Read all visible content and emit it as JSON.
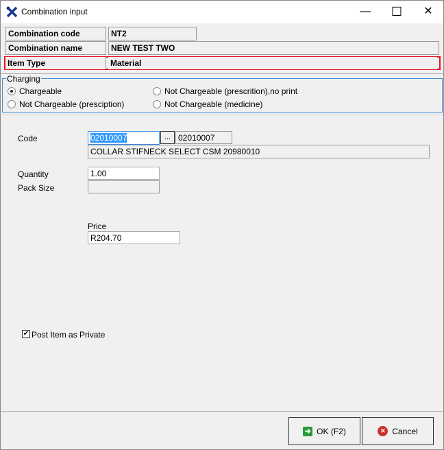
{
  "window": {
    "title": "Combination input",
    "minimize": "—",
    "maximize": "☐",
    "close": "✕"
  },
  "header": {
    "combination_code_label": "Combination code",
    "combination_code": "NT2",
    "combination_name_label": "Combination name",
    "combination_name": "NEW TEST TWO",
    "item_type_label": "Item Type",
    "item_type": "Material"
  },
  "charging": {
    "legend": "Charging",
    "options": [
      {
        "label": "Chargeable",
        "selected": true
      },
      {
        "label": "Not Chargeable (prescrition),no print",
        "selected": false
      },
      {
        "label": "Not Chargeable (presciption)",
        "selected": false
      },
      {
        "label": "Not Chargeable (medicine)",
        "selected": false
      }
    ]
  },
  "form": {
    "code_label": "Code",
    "code_value": "02010007",
    "browse_label": "...",
    "code_display": "02010007",
    "description": "COLLAR STIFNECK SELECT CSM 20980010",
    "quantity_label": "Quantity",
    "quantity": "1.00",
    "pack_size_label": "Pack Size",
    "pack_size": "",
    "price_label": "Price",
    "price": "R204.70",
    "post_private_label": "Post Item as Private",
    "post_private": true
  },
  "footer": {
    "ok_label": "OK (F2)",
    "cancel_label": "Cancel"
  },
  "colors": {
    "highlight": "#e81123",
    "group_border": "#3c8fd8",
    "selection": "#3399ff"
  }
}
